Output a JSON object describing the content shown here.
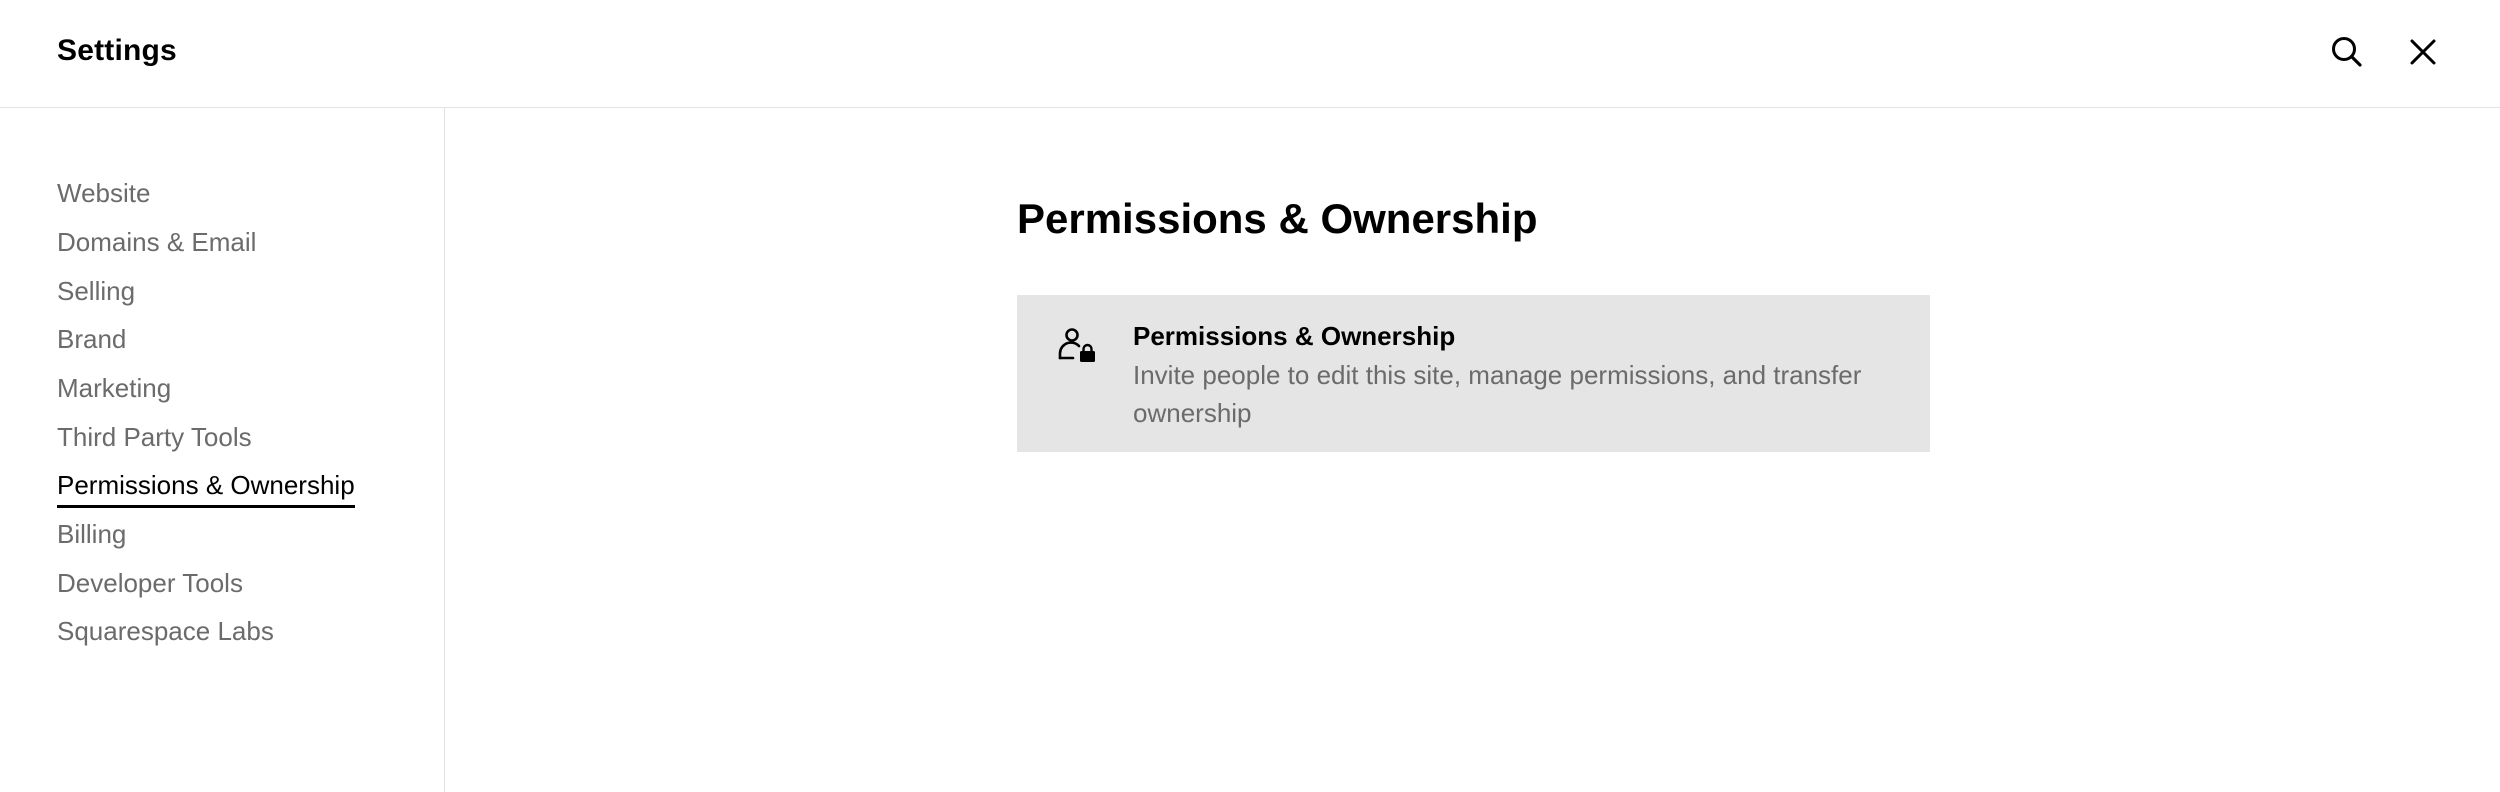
{
  "header": {
    "title": "Settings"
  },
  "icons": {
    "search": "search-icon",
    "close": "close-icon",
    "card": "user-lock-icon"
  },
  "sidebar": {
    "items": [
      {
        "label": "Website"
      },
      {
        "label": "Domains & Email"
      },
      {
        "label": "Selling"
      },
      {
        "label": "Brand"
      },
      {
        "label": "Marketing"
      },
      {
        "label": "Third Party Tools"
      },
      {
        "label": "Permissions & Ownership",
        "active": true
      },
      {
        "label": "Billing"
      },
      {
        "label": "Developer Tools"
      },
      {
        "label": "Squarespace Labs"
      }
    ]
  },
  "main": {
    "title": "Permissions & Ownership",
    "card": {
      "title": "Permissions & Ownership",
      "description": "Invite people to edit this site, manage permissions, and transfer ownership"
    }
  },
  "colors": {
    "text": "#000000",
    "muted": "#6b6b6b",
    "card_bg": "#e5e5e5",
    "divider": "#e3e3e3"
  }
}
